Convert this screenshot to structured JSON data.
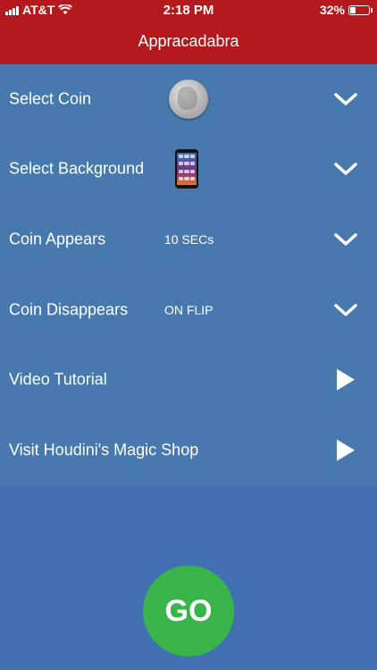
{
  "status_bar": {
    "carrier": "AT&T",
    "time": "2:18 PM",
    "battery": "32%",
    "battery_level": 0.32
  },
  "header": {
    "title": "Appracadabra"
  },
  "menu": {
    "items": [
      {
        "label": "Select Coin",
        "value": "",
        "accessory": "chevron-down-icon",
        "preview": "quarter-coin-icon"
      },
      {
        "label": "Select Background",
        "value": "",
        "accessory": "chevron-down-icon",
        "preview": "phone-background-icon"
      },
      {
        "label": "Coin Appears",
        "value": "10 SECs",
        "accessory": "chevron-down-icon"
      },
      {
        "label": "Coin Disappears",
        "value": "ON FLIP",
        "accessory": "chevron-down-icon"
      },
      {
        "label": "Video Tutorial",
        "value": "",
        "accessory": "play-icon"
      },
      {
        "label": "Visit Houdini's Magic Shop",
        "value": "",
        "accessory": "play-icon"
      }
    ]
  },
  "go_button": {
    "label": "GO"
  },
  "colors": {
    "header_bg": "#b4191d",
    "menu_bg": "#4778ae",
    "page_bg": "#4170b3",
    "go_bg": "#39b44a",
    "text": "#ffffff"
  }
}
